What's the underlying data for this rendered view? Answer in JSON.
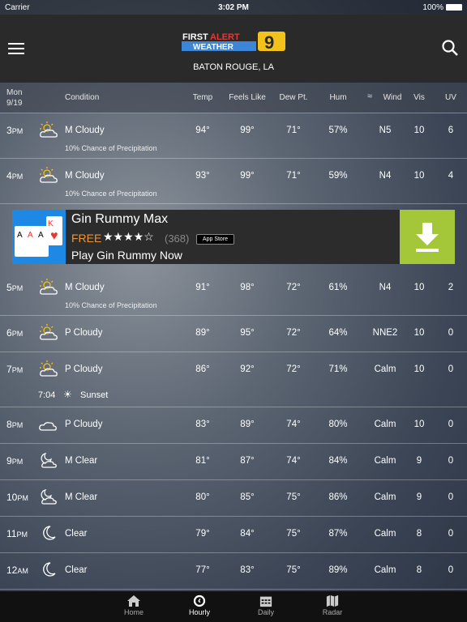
{
  "status": {
    "carrier": "Carrier",
    "time": "3:02 PM",
    "battery": "100%"
  },
  "header": {
    "logo_text": "FIRST ALERT WEATHER 9",
    "city": "BATON ROUGE, LA"
  },
  "table_header": {
    "day": "Mon",
    "date": "9/19",
    "condition": "Condition",
    "temp": "Temp",
    "feels": "Feels Like",
    "dew": "Dew Pt.",
    "hum": "Hum",
    "wind": "Wind",
    "vis": "Vis",
    "uv": "UV"
  },
  "rows": [
    {
      "time": "3",
      "ampm": "PM",
      "icon": "partly-cloudy-sun-icon",
      "cond": "M Cloudy",
      "temp": "94°",
      "feels": "99°",
      "dew": "71°",
      "hum": "57%",
      "wind": "N5",
      "vis": "10",
      "uv": "6",
      "sub": "10% Chance of Precipitation"
    },
    {
      "time": "4",
      "ampm": "PM",
      "icon": "partly-cloudy-sun-icon",
      "cond": "M Cloudy",
      "temp": "93°",
      "feels": "99°",
      "dew": "71°",
      "hum": "59%",
      "wind": "N4",
      "vis": "10",
      "uv": "4",
      "sub": "10% Chance of Precipitation"
    },
    {
      "time": "5",
      "ampm": "PM",
      "icon": "partly-cloudy-sun-icon",
      "cond": "M Cloudy",
      "temp": "91°",
      "feels": "98°",
      "dew": "72°",
      "hum": "61%",
      "wind": "N4",
      "vis": "10",
      "uv": "2",
      "sub": "10% Chance of Precipitation"
    },
    {
      "time": "6",
      "ampm": "PM",
      "icon": "partly-cloudy-sun-icon",
      "cond": "P Cloudy",
      "temp": "89°",
      "feels": "95°",
      "dew": "72°",
      "hum": "64%",
      "wind": "NNE2",
      "vis": "10",
      "uv": "0"
    },
    {
      "time": "7",
      "ampm": "PM",
      "icon": "partly-cloudy-sun-icon",
      "cond": "P Cloudy",
      "temp": "86°",
      "feels": "92°",
      "dew": "72°",
      "hum": "71%",
      "wind": "Calm",
      "vis": "10",
      "uv": "0",
      "sunset_time": "7:04",
      "sunset_label": "Sunset"
    },
    {
      "time": "8",
      "ampm": "PM",
      "icon": "cloud-icon",
      "cond": "P Cloudy",
      "temp": "83°",
      "feels": "89°",
      "dew": "74°",
      "hum": "80%",
      "wind": "Calm",
      "vis": "10",
      "uv": "0"
    },
    {
      "time": "9",
      "ampm": "PM",
      "icon": "partly-cloudy-moon-icon",
      "cond": "M Clear",
      "temp": "81°",
      "feels": "87°",
      "dew": "74°",
      "hum": "84%",
      "wind": "Calm",
      "vis": "9",
      "uv": "0"
    },
    {
      "time": "10",
      "ampm": "PM",
      "icon": "partly-cloudy-moon-icon",
      "cond": "M Clear",
      "temp": "80°",
      "feels": "85°",
      "dew": "75°",
      "hum": "86%",
      "wind": "Calm",
      "vis": "9",
      "uv": "0"
    },
    {
      "time": "11",
      "ampm": "PM",
      "icon": "moon-icon",
      "cond": "Clear",
      "temp": "79°",
      "feels": "84°",
      "dew": "75°",
      "hum": "87%",
      "wind": "Calm",
      "vis": "8",
      "uv": "0"
    },
    {
      "time": "12",
      "ampm": "AM",
      "icon": "moon-icon",
      "cond": "Clear",
      "temp": "77°",
      "feels": "83°",
      "dew": "75°",
      "hum": "89%",
      "wind": "Calm",
      "vis": "8",
      "uv": "0"
    }
  ],
  "ad": {
    "title": "Gin Rummy Max",
    "price": "FREE",
    "rating": 4.5,
    "stars": "★★★★☆",
    "count": "(368)",
    "badge": "App Store",
    "cta": "Play Gin Rummy Now",
    "accent": "#a4c639"
  },
  "tabs": [
    {
      "label": "Home",
      "icon": "home-icon"
    },
    {
      "label": "Hourly",
      "icon": "clock-icon",
      "active": true
    },
    {
      "label": "Daily",
      "icon": "calendar-icon"
    },
    {
      "label": "Radar",
      "icon": "map-icon"
    }
  ]
}
